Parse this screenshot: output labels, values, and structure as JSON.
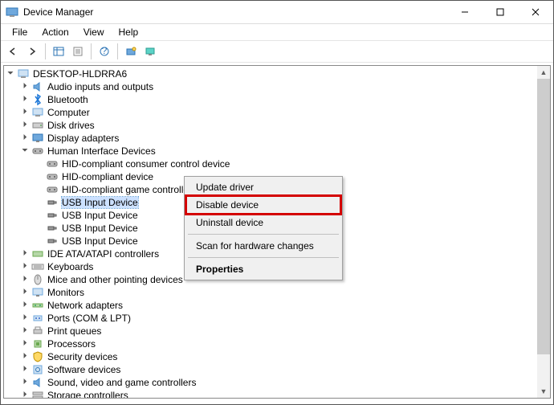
{
  "window": {
    "title": "Device Manager"
  },
  "menus": {
    "file": "File",
    "action": "Action",
    "view": "View",
    "help": "Help"
  },
  "tree": {
    "root": "DESKTOP-HLDRRA6",
    "nodes": [
      {
        "label": "Audio inputs and outputs",
        "icon": "audio",
        "expanded": false,
        "hasChildren": true
      },
      {
        "label": "Bluetooth",
        "icon": "bluetooth",
        "expanded": false,
        "hasChildren": true
      },
      {
        "label": "Computer",
        "icon": "computer",
        "expanded": false,
        "hasChildren": true
      },
      {
        "label": "Disk drives",
        "icon": "disk",
        "expanded": false,
        "hasChildren": true
      },
      {
        "label": "Display adapters",
        "icon": "display",
        "expanded": false,
        "hasChildren": true
      },
      {
        "label": "Human Interface Devices",
        "icon": "hid",
        "expanded": true,
        "hasChildren": true,
        "children": [
          {
            "label": "HID-compliant consumer control device",
            "icon": "hid"
          },
          {
            "label": "HID-compliant device",
            "icon": "hid"
          },
          {
            "label": "HID-compliant game controller",
            "icon": "hid"
          },
          {
            "label": "USB Input Device",
            "icon": "usb",
            "selected": true
          },
          {
            "label": "USB Input Device",
            "icon": "usb"
          },
          {
            "label": "USB Input Device",
            "icon": "usb"
          },
          {
            "label": "USB Input Device",
            "icon": "usb"
          }
        ]
      },
      {
        "label": "IDE ATA/ATAPI controllers",
        "icon": "ide",
        "expanded": false,
        "hasChildren": true
      },
      {
        "label": "Keyboards",
        "icon": "keyboard",
        "expanded": false,
        "hasChildren": true
      },
      {
        "label": "Mice and other pointing devices",
        "icon": "mouse",
        "expanded": false,
        "hasChildren": true
      },
      {
        "label": "Monitors",
        "icon": "monitor",
        "expanded": false,
        "hasChildren": true
      },
      {
        "label": "Network adapters",
        "icon": "network",
        "expanded": false,
        "hasChildren": true
      },
      {
        "label": "Ports (COM & LPT)",
        "icon": "port",
        "expanded": false,
        "hasChildren": true
      },
      {
        "label": "Print queues",
        "icon": "printer",
        "expanded": false,
        "hasChildren": true
      },
      {
        "label": "Processors",
        "icon": "cpu",
        "expanded": false,
        "hasChildren": true
      },
      {
        "label": "Security devices",
        "icon": "security",
        "expanded": false,
        "hasChildren": true
      },
      {
        "label": "Software devices",
        "icon": "software",
        "expanded": false,
        "hasChildren": true
      },
      {
        "label": "Sound, video and game controllers",
        "icon": "audio",
        "expanded": false,
        "hasChildren": true
      },
      {
        "label": "Storage controllers",
        "icon": "storage",
        "expanded": false,
        "hasChildren": true
      }
    ]
  },
  "context_menu": {
    "update": "Update driver",
    "disable": "Disable device",
    "uninstall": "Uninstall device",
    "scan": "Scan for hardware changes",
    "properties": "Properties"
  }
}
